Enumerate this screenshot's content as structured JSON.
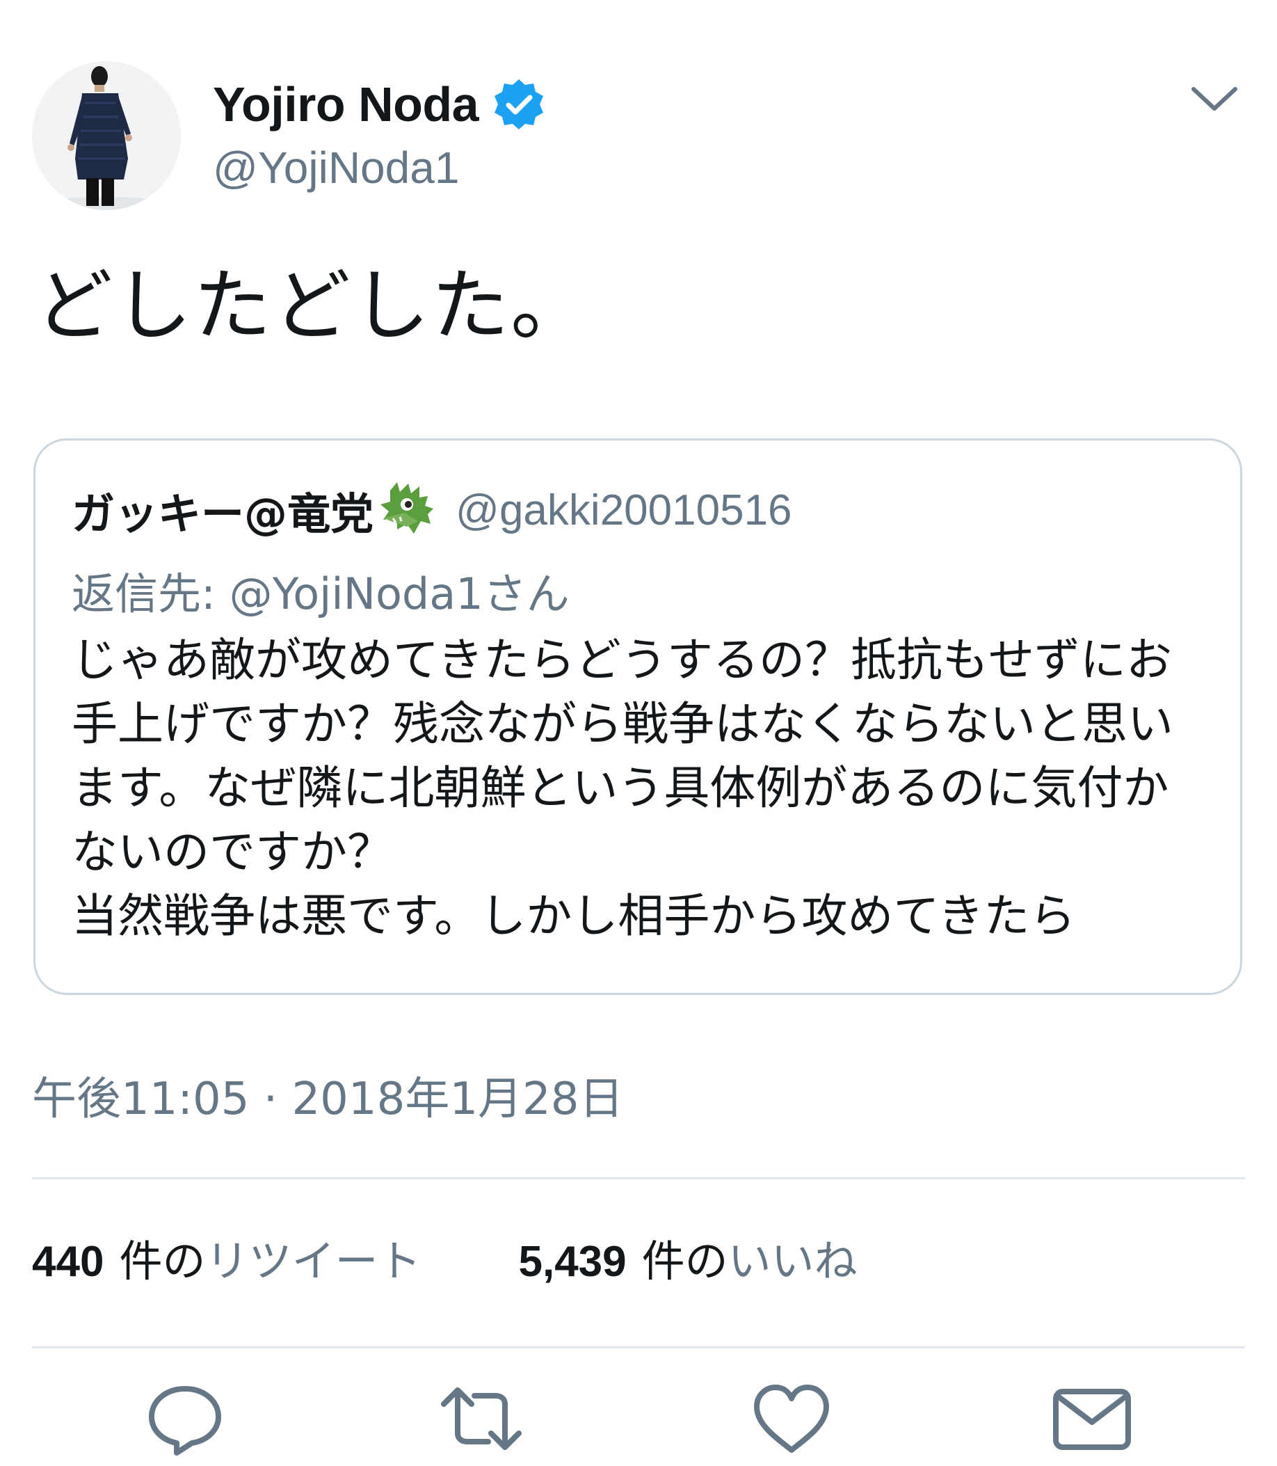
{
  "tweet": {
    "author": {
      "display_name": "Yojiro Noda",
      "handle": "@YojiNoda1",
      "verified": true
    },
    "text": "どしたどした。",
    "quoted": {
      "display_name": "ガッキー@竜党",
      "emoji_icon": "dragon-face",
      "handle": "@gakki20010516",
      "reply_to": "返信先: @YojiNoda1さん",
      "text": "じゃあ敵が攻めてきたらどうするの？抵抗もせずにお手上げですか？残念ながら戦争はなくならないと思います。なぜ隣に北朝鮮という具体例があるのに気付かないのですか？\n当然戦争は悪です。しかし相手から攻めてきたら"
    },
    "timestamp": "午後11:05 · 2018年1月28日",
    "stats": {
      "retweets_count": "440",
      "retweets_unit": "件の",
      "retweets_label": "リツイート",
      "likes_count": "5,439",
      "likes_unit": "件の",
      "likes_label": "いいね"
    }
  },
  "actions": [
    "reply-icon",
    "retweet-icon",
    "like-icon",
    "share-icon"
  ],
  "colors": {
    "text": "#14171a",
    "secondary": "#657786",
    "verified_blue": "#1da1f2",
    "border": "#ccd6dd",
    "divider": "#e1e8ed"
  }
}
